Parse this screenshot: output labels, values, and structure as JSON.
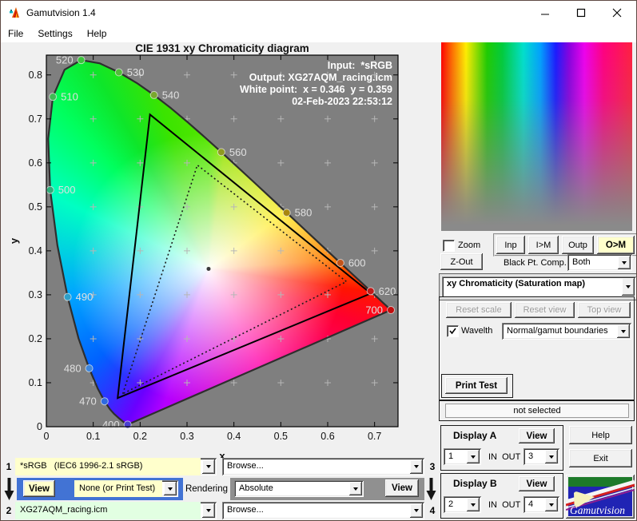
{
  "window": {
    "title": "Gamutvision 1.4",
    "menu": [
      "File",
      "Settings",
      "Help"
    ]
  },
  "colors": {
    "plot_bg": "#7f7f7f",
    "field_yellow": "#ffffcc",
    "field_green": "#e2ffe2",
    "panel_blue": "#4273d4",
    "panel_gray": "#909090",
    "active_button_bg": "#ffffcc"
  },
  "chart_data": {
    "type": "scatter",
    "title": "CIE 1931 xy Chromaticity diagram",
    "xlabel": "x",
    "ylabel": "y",
    "xlim": [
      0,
      0.75
    ],
    "ylim": [
      0,
      0.845
    ],
    "xticks": [
      0,
      0.1,
      0.2,
      0.3,
      0.4,
      0.5,
      0.6,
      0.7
    ],
    "yticks": [
      0,
      0.1,
      0.2,
      0.3,
      0.4,
      0.5,
      0.6,
      0.7,
      0.8
    ],
    "annotation_lines": [
      "Input:  *sRGB",
      "Output: XG27AQM_racing.icm",
      "White point:  x = 0.346  y = 0.359",
      "02-Feb-2023 22:53:12"
    ],
    "white_point": {
      "x": 0.346,
      "y": 0.359
    },
    "spectral_locus": [
      [
        0.1733,
        0.0048
      ],
      [
        0.1689,
        0.0069
      ],
      [
        0.1644,
        0.0109
      ],
      [
        0.1566,
        0.0177
      ],
      [
        0.144,
        0.0297
      ],
      [
        0.1355,
        0.0399
      ],
      [
        0.1241,
        0.0578
      ],
      [
        0.1096,
        0.0868
      ],
      [
        0.0913,
        0.1327
      ],
      [
        0.0687,
        0.2007
      ],
      [
        0.0454,
        0.295
      ],
      [
        0.0235,
        0.4127
      ],
      [
        0.0082,
        0.5384
      ],
      [
        0.0039,
        0.6548
      ],
      [
        0.0139,
        0.7502
      ],
      [
        0.0389,
        0.812
      ],
      [
        0.0743,
        0.8338
      ],
      [
        0.1142,
        0.8262
      ],
      [
        0.1547,
        0.8059
      ],
      [
        0.1929,
        0.7816
      ],
      [
        0.2296,
        0.7543
      ],
      [
        0.2658,
        0.7243
      ],
      [
        0.3016,
        0.6923
      ],
      [
        0.3373,
        0.6589
      ],
      [
        0.3731,
        0.6245
      ],
      [
        0.4087,
        0.5896
      ],
      [
        0.4441,
        0.5547
      ],
      [
        0.4788,
        0.5202
      ],
      [
        0.5125,
        0.4866
      ],
      [
        0.5448,
        0.4544
      ],
      [
        0.5752,
        0.4242
      ],
      [
        0.6029,
        0.3965
      ],
      [
        0.627,
        0.3725
      ],
      [
        0.6482,
        0.3514
      ],
      [
        0.6658,
        0.334
      ],
      [
        0.6801,
        0.3197
      ],
      [
        0.6915,
        0.3083
      ],
      [
        0.7006,
        0.2993
      ],
      [
        0.7079,
        0.292
      ],
      [
        0.719,
        0.2809
      ],
      [
        0.726,
        0.274
      ],
      [
        0.7347,
        0.2653
      ]
    ],
    "gamut_triangles": [
      {
        "name": "output-gamut",
        "style": "solid",
        "vertices": [
          [
            0.152,
            0.065
          ],
          [
            0.221,
            0.71
          ],
          [
            0.692,
            0.303
          ]
        ]
      },
      {
        "name": "input-srgb-gamut",
        "style": "dotted",
        "vertices": [
          [
            0.163,
            0.075
          ],
          [
            0.322,
            0.595
          ],
          [
            0.64,
            0.33
          ]
        ]
      }
    ],
    "wavelength_markers": [
      {
        "nm": "400",
        "x": 0.1733,
        "y": 0.0048,
        "color": "#4a3fd0",
        "side": "left"
      },
      {
        "nm": "470",
        "x": 0.1241,
        "y": 0.0578,
        "color": "#2f6ae0",
        "side": "left"
      },
      {
        "nm": "480",
        "x": 0.0913,
        "y": 0.1327,
        "color": "#3f86d9",
        "side": "left"
      },
      {
        "nm": "490",
        "x": 0.0454,
        "y": 0.295,
        "color": "#2f9fc8",
        "side": "right"
      },
      {
        "nm": "500",
        "x": 0.0082,
        "y": 0.5384,
        "color": "#2fae7a",
        "side": "right"
      },
      {
        "nm": "510",
        "x": 0.0139,
        "y": 0.7502,
        "color": "#3fb954",
        "side": "right"
      },
      {
        "nm": "520",
        "x": 0.0743,
        "y": 0.8338,
        "color": "#3cc53c",
        "side": "left"
      },
      {
        "nm": "530",
        "x": 0.1547,
        "y": 0.8059,
        "color": "#52bb3a",
        "side": "right"
      },
      {
        "nm": "540",
        "x": 0.2296,
        "y": 0.7543,
        "color": "#79a72e",
        "side": "right"
      },
      {
        "nm": "560",
        "x": 0.3731,
        "y": 0.6245,
        "color": "#8f9a20",
        "side": "right"
      },
      {
        "nm": "580",
        "x": 0.5125,
        "y": 0.4866,
        "color": "#a8860e",
        "side": "right"
      },
      {
        "nm": "600",
        "x": 0.627,
        "y": 0.3725,
        "color": "#c2541a",
        "side": "right"
      },
      {
        "nm": "620",
        "x": 0.6915,
        "y": 0.3083,
        "color": "#c01818",
        "side": "right"
      },
      {
        "nm": "700",
        "x": 0.7347,
        "y": 0.2653,
        "color": "#c00d0d",
        "side": "left"
      }
    ],
    "grid_plus": {
      "x_step": 0.1,
      "y_step": 0.1,
      "x_range": [
        0.1,
        0.7
      ],
      "y_range": [
        0.1,
        0.8
      ],
      "color": "#b6b6b6"
    }
  },
  "preview": {
    "stops": [
      {
        "color": "#ff0000",
        "pos": 0
      },
      {
        "color": "#ff7300",
        "pos": 6
      },
      {
        "color": "#ffee00",
        "pos": 13
      },
      {
        "color": "#1ecc00",
        "pos": 24
      },
      {
        "color": "#00cc3c",
        "pos": 32
      },
      {
        "color": "#00e0cc",
        "pos": 43
      },
      {
        "color": "#00a0ff",
        "pos": 52
      },
      {
        "color": "#1a1aff",
        "pos": 60
      },
      {
        "color": "#8800e0",
        "pos": 67
      },
      {
        "color": "#ee00ee",
        "pos": 75
      },
      {
        "color": "#ff0080",
        "pos": 85
      },
      {
        "color": "#ff2040",
        "pos": 100
      }
    ],
    "fade_color": "#8a8a8a"
  },
  "right_panel": {
    "zoom_checkbox": {
      "label": "Zoom",
      "checked": false
    },
    "buttons": {
      "inp": "Inp",
      "im": "I>M",
      "outp": "Outp",
      "om": "O>M",
      "zout": "Z-Out"
    },
    "black_pt": {
      "label": "Black Pt. Comp.",
      "value": "Both"
    },
    "mode_select": "xy Chromaticity (Saturation map)",
    "view_buttons": {
      "reset_scale": "Reset scale",
      "reset_view": "Reset view",
      "top_view": "Top view"
    },
    "wavelength_checkbox": {
      "label": "Wavelth",
      "checked": true
    },
    "boundaries_select": "Normal/gamut boundaries",
    "print_test": "Print Test",
    "status": "not selected",
    "help": "Help",
    "exit": "Exit"
  },
  "displays": {
    "a": {
      "title": "Display A",
      "view": "View",
      "in_value": "1",
      "inout_label": "IN  OUT",
      "out_value": "3"
    },
    "b": {
      "title": "Display B",
      "view": "View",
      "in_value": "2",
      "inout_label": "IN  OUT",
      "out_value": "4"
    }
  },
  "logo": {
    "text": "Gamutvision"
  },
  "bottom": {
    "row1": {
      "num": "1",
      "profile": "*sRGB   (IEC6 1996-2.1 sRGB)",
      "browse": "Browse...",
      "num_right": "3"
    },
    "mid": {
      "view_a": "View",
      "print_select": "None (or Print Test)",
      "rendering_label": "Rendering",
      "intent": "Absolute",
      "view_b": "View"
    },
    "row2": {
      "num": "2",
      "profile": "XG27AQM_racing.icm",
      "browse": "Browse...",
      "num_right": "4"
    }
  }
}
